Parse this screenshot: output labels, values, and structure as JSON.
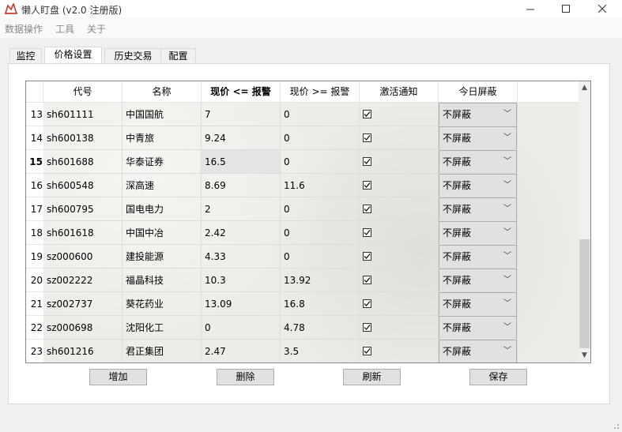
{
  "window": {
    "title": "懒人盯盘 (v2.0 注册版)",
    "minimize_icon": "minimize-icon",
    "maximize_icon": "maximize-icon",
    "close_icon": "close-icon"
  },
  "menu": [
    "数据操作",
    "工具",
    "关于"
  ],
  "tabs": [
    {
      "label": "监控",
      "active": false
    },
    {
      "label": "价格设置",
      "active": true
    },
    {
      "label": "历史交易",
      "active": false
    },
    {
      "label": "配置",
      "active": false
    }
  ],
  "table": {
    "columns": [
      "代号",
      "名称",
      "现价 <= 报警",
      "现价 >= 报警",
      "激活通知",
      "今日屏蔽"
    ],
    "current_row": 15,
    "rows": [
      {
        "num": "13",
        "code": "sh601111",
        "name": "中国国航",
        "low": "7",
        "high": "0",
        "notify": true,
        "block": "不屏蔽"
      },
      {
        "num": "14",
        "code": "sh600138",
        "name": "中青旅",
        "low": "9.24",
        "high": "0",
        "notify": true,
        "block": "不屏蔽"
      },
      {
        "num": "15",
        "code": "sh601688",
        "name": "华泰证券",
        "low": "16.5",
        "high": "0",
        "notify": true,
        "block": "不屏蔽"
      },
      {
        "num": "16",
        "code": "sh600548",
        "name": "深高速",
        "low": "8.69",
        "high": "11.6",
        "notify": true,
        "block": "不屏蔽"
      },
      {
        "num": "17",
        "code": "sh600795",
        "name": "国电电力",
        "low": "2",
        "high": "0",
        "notify": true,
        "block": "不屏蔽"
      },
      {
        "num": "18",
        "code": "sh601618",
        "name": "中国中冶",
        "low": "2.42",
        "high": "0",
        "notify": true,
        "block": "不屏蔽"
      },
      {
        "num": "19",
        "code": "sz000600",
        "name": "建投能源",
        "low": "4.33",
        "high": "0",
        "notify": true,
        "block": "不屏蔽"
      },
      {
        "num": "20",
        "code": "sz002222",
        "name": "福晶科技",
        "low": "10.3",
        "high": "13.92",
        "notify": true,
        "block": "不屏蔽"
      },
      {
        "num": "21",
        "code": "sz002737",
        "name": "葵花药业",
        "low": "13.09",
        "high": "16.8",
        "notify": true,
        "block": "不屏蔽"
      },
      {
        "num": "22",
        "code": "sz000698",
        "name": "沈阳化工",
        "low": "0",
        "high": "4.78",
        "notify": true,
        "block": "不屏蔽"
      },
      {
        "num": "23",
        "code": "sh601216",
        "name": "君正集团",
        "low": "2.47",
        "high": "3.5",
        "notify": true,
        "block": "不屏蔽"
      }
    ]
  },
  "buttons": {
    "add": "增加",
    "delete": "删除",
    "refresh": "刷新",
    "save": "保存"
  },
  "colors": {
    "grid_border": "#828790",
    "button_bg": "#e1e1e1",
    "app_icon": "#c0392b"
  }
}
